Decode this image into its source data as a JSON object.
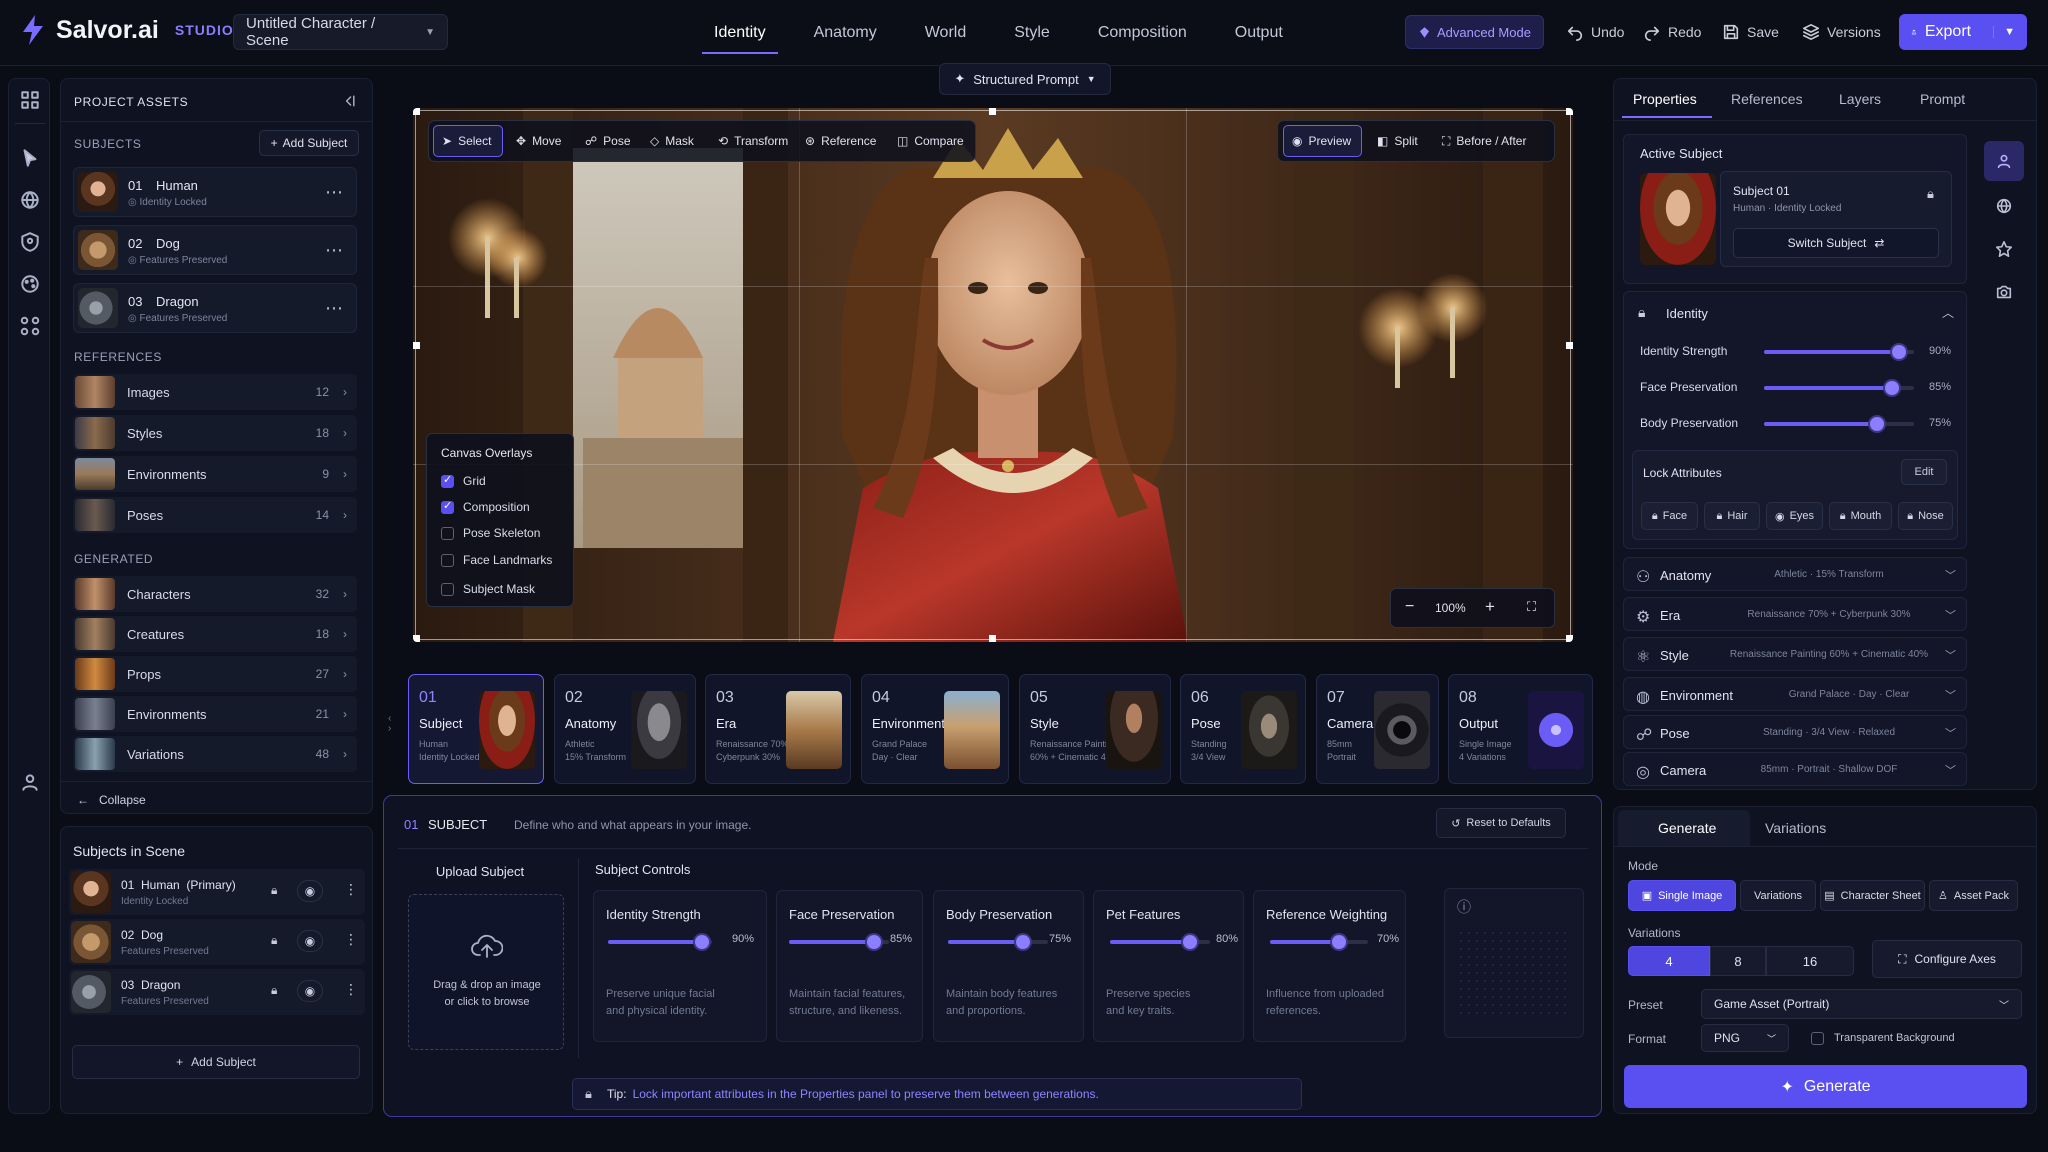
{
  "app": {
    "name": "Salvor.ai",
    "badge": "STUDIO",
    "project": "Untitled Character / Scene"
  },
  "nav": {
    "tabs": [
      "Identity",
      "Anatomy",
      "World",
      "Style",
      "Composition",
      "Output"
    ],
    "active": 0
  },
  "toolbar": {
    "advanced": "Advanced Mode",
    "undo": "Undo",
    "redo": "Redo",
    "save": "Save",
    "versions": "Versions",
    "export": "Export"
  },
  "structured_prompt": "Structured Prompt",
  "left": {
    "title": "PROJECT ASSETS",
    "subjects_label": "SUBJECTS",
    "add_subject": "Add Subject",
    "subjects": [
      {
        "num": "01",
        "name": "Human",
        "sub": "Identity Locked"
      },
      {
        "num": "02",
        "name": "Dog",
        "sub": "Features Preserved"
      },
      {
        "num": "03",
        "name": "Dragon",
        "sub": "Features Preserved"
      }
    ],
    "references_label": "REFERENCES",
    "references": [
      {
        "name": "Images",
        "count": "12"
      },
      {
        "name": "Styles",
        "count": "18"
      },
      {
        "name": "Environments",
        "count": "9"
      },
      {
        "name": "Poses",
        "count": "14"
      }
    ],
    "generated_label": "GENERATED",
    "generated": [
      {
        "name": "Characters",
        "count": "32"
      },
      {
        "name": "Creatures",
        "count": "18"
      },
      {
        "name": "Props",
        "count": "27"
      },
      {
        "name": "Environments",
        "count": "21"
      },
      {
        "name": "Variations",
        "count": "48"
      }
    ],
    "collapse": "Collapse",
    "scene_title": "Subjects in Scene",
    "scene": [
      {
        "label": "01  Human  (Primary)",
        "sub": "Identity Locked"
      },
      {
        "label": "02  Dog",
        "sub": "Features Preserved"
      },
      {
        "label": "03  Dragon",
        "sub": "Features Preserved"
      }
    ],
    "scene_add": "Add Subject"
  },
  "canvas_tools": [
    "Select",
    "Move",
    "Pose",
    "Mask",
    "Transform",
    "Reference",
    "Compare"
  ],
  "view_tools": [
    "Preview",
    "Split",
    "Before / After"
  ],
  "overlays": {
    "title": "Canvas Overlays",
    "items": [
      {
        "label": "Grid",
        "on": true
      },
      {
        "label": "Composition",
        "on": true
      },
      {
        "label": "Pose Skeleton",
        "on": false
      },
      {
        "label": "Face Landmarks",
        "on": false
      },
      {
        "label": "Subject Mask",
        "on": false
      }
    ]
  },
  "zoom": "100%",
  "steps": [
    {
      "num": "01",
      "title": "Subject",
      "sub": "Human\nIdentity Locked"
    },
    {
      "num": "02",
      "title": "Anatomy",
      "sub": "Athletic\n15% Transform"
    },
    {
      "num": "03",
      "title": "Era",
      "sub": "Renaissance 70%\nCyberpunk 30%"
    },
    {
      "num": "04",
      "title": "Environment",
      "sub": "Grand Palace\nDay · Clear"
    },
    {
      "num": "05",
      "title": "Style",
      "sub": "Renaissance Painting\n60% + Cinematic 40%"
    },
    {
      "num": "06",
      "title": "Pose",
      "sub": "Standing\n3/4 View"
    },
    {
      "num": "07",
      "title": "Camera",
      "sub": "85mm\nPortrait"
    },
    {
      "num": "08",
      "title": "Output",
      "sub": "Single Image\n4 Variations"
    }
  ],
  "subject_panel": {
    "num": "01",
    "title": "SUBJECT",
    "desc": "Define who and what appears in your image.",
    "reset": "Reset to Defaults",
    "upload_title": "Upload Subject",
    "upload_text1": "Drag & drop an image",
    "upload_text2": "or click to browse",
    "controls_title": "Subject Controls",
    "controls": [
      {
        "name": "Identity Strength",
        "value": 90,
        "label": "90%",
        "desc": "Preserve unique facial\nand physical identity."
      },
      {
        "name": "Face Preservation",
        "value": 85,
        "label": "85%",
        "desc": "Maintain facial features,\nstructure, and likeness."
      },
      {
        "name": "Body Preservation",
        "value": 75,
        "label": "75%",
        "desc": "Maintain body features\nand proportions."
      },
      {
        "name": "Pet Features",
        "value": 80,
        "label": "80%",
        "desc": "Preserve species\nand key traits."
      },
      {
        "name": "Reference Weighting",
        "value": 70,
        "label": "70%",
        "desc": "Influence from uploaded\nreferences."
      }
    ],
    "tip_label": "Tip:",
    "tip": "Lock important attributes in the Properties panel to preserve them between generations."
  },
  "right": {
    "tabs": [
      "Properties",
      "References",
      "Layers",
      "Prompt"
    ],
    "active_subject_label": "Active Subject",
    "subject_name": "Subject 01",
    "subject_sub": "Human · Identity Locked",
    "switch": "Switch Subject",
    "identity_title": "Identity",
    "sliders": [
      {
        "name": "Identity Strength",
        "value": 90,
        "label": "90%"
      },
      {
        "name": "Face Preservation",
        "value": 85,
        "label": "85%"
      },
      {
        "name": "Body Preservation",
        "value": 75,
        "label": "75%"
      }
    ],
    "lock_title": "Lock Attributes",
    "edit": "Edit",
    "locks": [
      "Face",
      "Hair",
      "Eyes",
      "Mouth",
      "Nose"
    ],
    "accordions": [
      {
        "title": "Anatomy",
        "value": "Athletic · 15% Transform"
      },
      {
        "title": "Era",
        "value": "Renaissance 70% + Cyberpunk 30%"
      },
      {
        "title": "Style",
        "value": "Renaissance Painting 60% + Cinematic 40%"
      },
      {
        "title": "Environment",
        "value": "Grand Palace · Day · Clear"
      },
      {
        "title": "Pose",
        "value": "Standing · 3/4 View · Relaxed"
      },
      {
        "title": "Camera",
        "value": "85mm · Portrait · Shallow DOF"
      }
    ],
    "gen_tabs": [
      "Generate",
      "Variations"
    ],
    "mode_label": "Mode",
    "modes": [
      "Single Image",
      "Variations",
      "Character Sheet",
      "Asset Pack"
    ],
    "variations_label": "Variations",
    "variations": [
      "4",
      "8",
      "16"
    ],
    "configure": "Configure Axes",
    "preset_label": "Preset",
    "preset": "Game Asset (Portrait)",
    "format_label": "Format",
    "format": "PNG",
    "transparent": "Transparent Background",
    "generate": "Generate"
  },
  "colors": {
    "accent": "#5a4ff0",
    "accent_light": "#8b7eff",
    "bg": "#0b0d16"
  }
}
